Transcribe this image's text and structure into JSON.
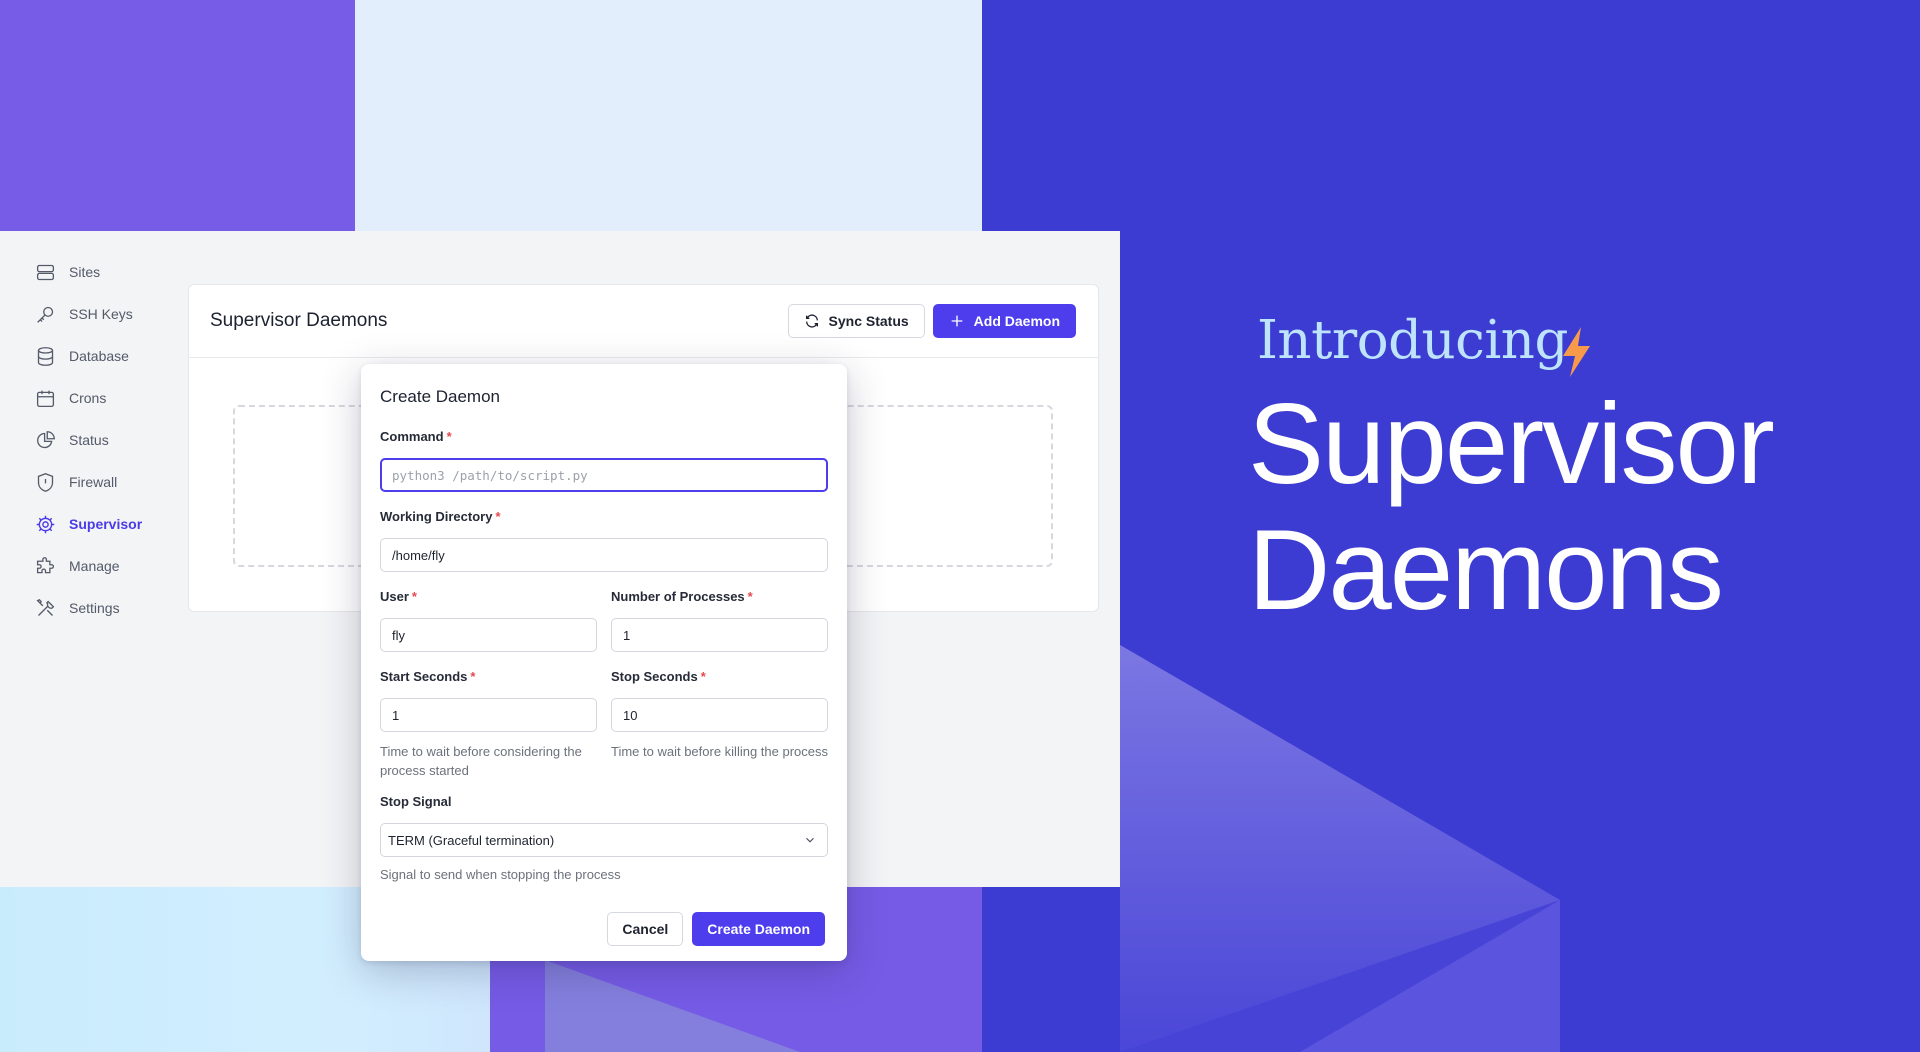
{
  "sidebar": {
    "items": [
      {
        "label": "Sites",
        "icon": "server-stack-icon"
      },
      {
        "label": "SSH Keys",
        "icon": "key-icon"
      },
      {
        "label": "Database",
        "icon": "database-icon"
      },
      {
        "label": "Crons",
        "icon": "calendar-icon"
      },
      {
        "label": "Status",
        "icon": "pie-chart-icon"
      },
      {
        "label": "Firewall",
        "icon": "shield-icon"
      },
      {
        "label": "Supervisor",
        "icon": "gear-icon",
        "active": true
      },
      {
        "label": "Manage",
        "icon": "puzzle-icon"
      },
      {
        "label": "Settings",
        "icon": "wrench-screwdriver-icon"
      }
    ]
  },
  "panel": {
    "title": "Supervisor Daemons",
    "sync_label": "Sync Status",
    "add_label": "Add Daemon"
  },
  "modal": {
    "title": "Create Daemon",
    "command": {
      "label": "Command",
      "placeholder": "python3 /path/to/script.py",
      "value": ""
    },
    "working_directory": {
      "label": "Working Directory",
      "value": "/home/fly"
    },
    "user": {
      "label": "User",
      "value": "fly"
    },
    "num_processes": {
      "label": "Number of Processes",
      "value": "1"
    },
    "start_seconds": {
      "label": "Start Seconds",
      "value": "1",
      "hint": "Time to wait before considering the process started"
    },
    "stop_seconds": {
      "label": "Stop Seconds",
      "value": "10",
      "hint": "Time to wait before killing the process"
    },
    "stop_signal": {
      "label": "Stop Signal",
      "value": "TERM (Graceful termination)",
      "hint": "Signal to send when stopping the process"
    },
    "cancel_label": "Cancel",
    "create_label": "Create Daemon",
    "required_mark": "*"
  },
  "hero": {
    "intro": "Introducing",
    "line1": "Supervisor",
    "line2": "Daemons"
  },
  "colors": {
    "accent": "#4d3ded",
    "background": "#3d3cd2",
    "bolt": "#f79a4a",
    "required": "#e5484d"
  }
}
